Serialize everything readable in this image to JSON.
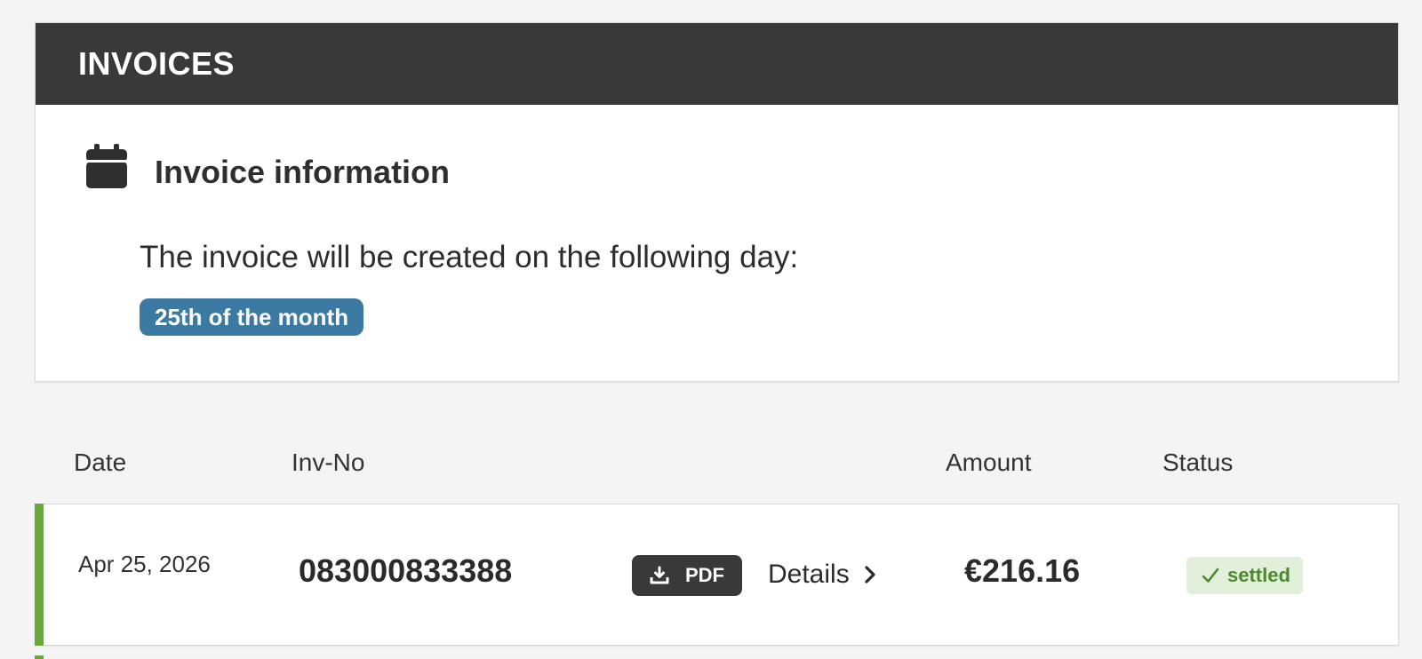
{
  "invoices": {
    "title": "INVOICES",
    "info": {
      "icon": "calendar-icon",
      "heading": "Invoice information",
      "text": "The invoice will be created on the following day:",
      "day_badge": "25th of the month",
      "badge_color": "#3d7aa3"
    }
  },
  "table": {
    "columns": {
      "date": "Date",
      "inv_no": "Inv-No",
      "amount": "Amount",
      "status": "Status"
    },
    "rows": [
      {
        "date": "Apr 25, 2026",
        "inv_no": "083000833388",
        "pdf_label": "PDF",
        "pdf_icon": "download-icon",
        "details_label": "Details",
        "details_icon": "chevron-right-icon",
        "amount": "€216.16",
        "status": "settled",
        "status_icon": "check-icon",
        "status_color": "#4a8a2a",
        "accent_color": "#69a83c"
      }
    ]
  },
  "colors": {
    "header_bg": "#393939",
    "page_bg": "#f4f4f4",
    "card_bg": "#ffffff"
  }
}
